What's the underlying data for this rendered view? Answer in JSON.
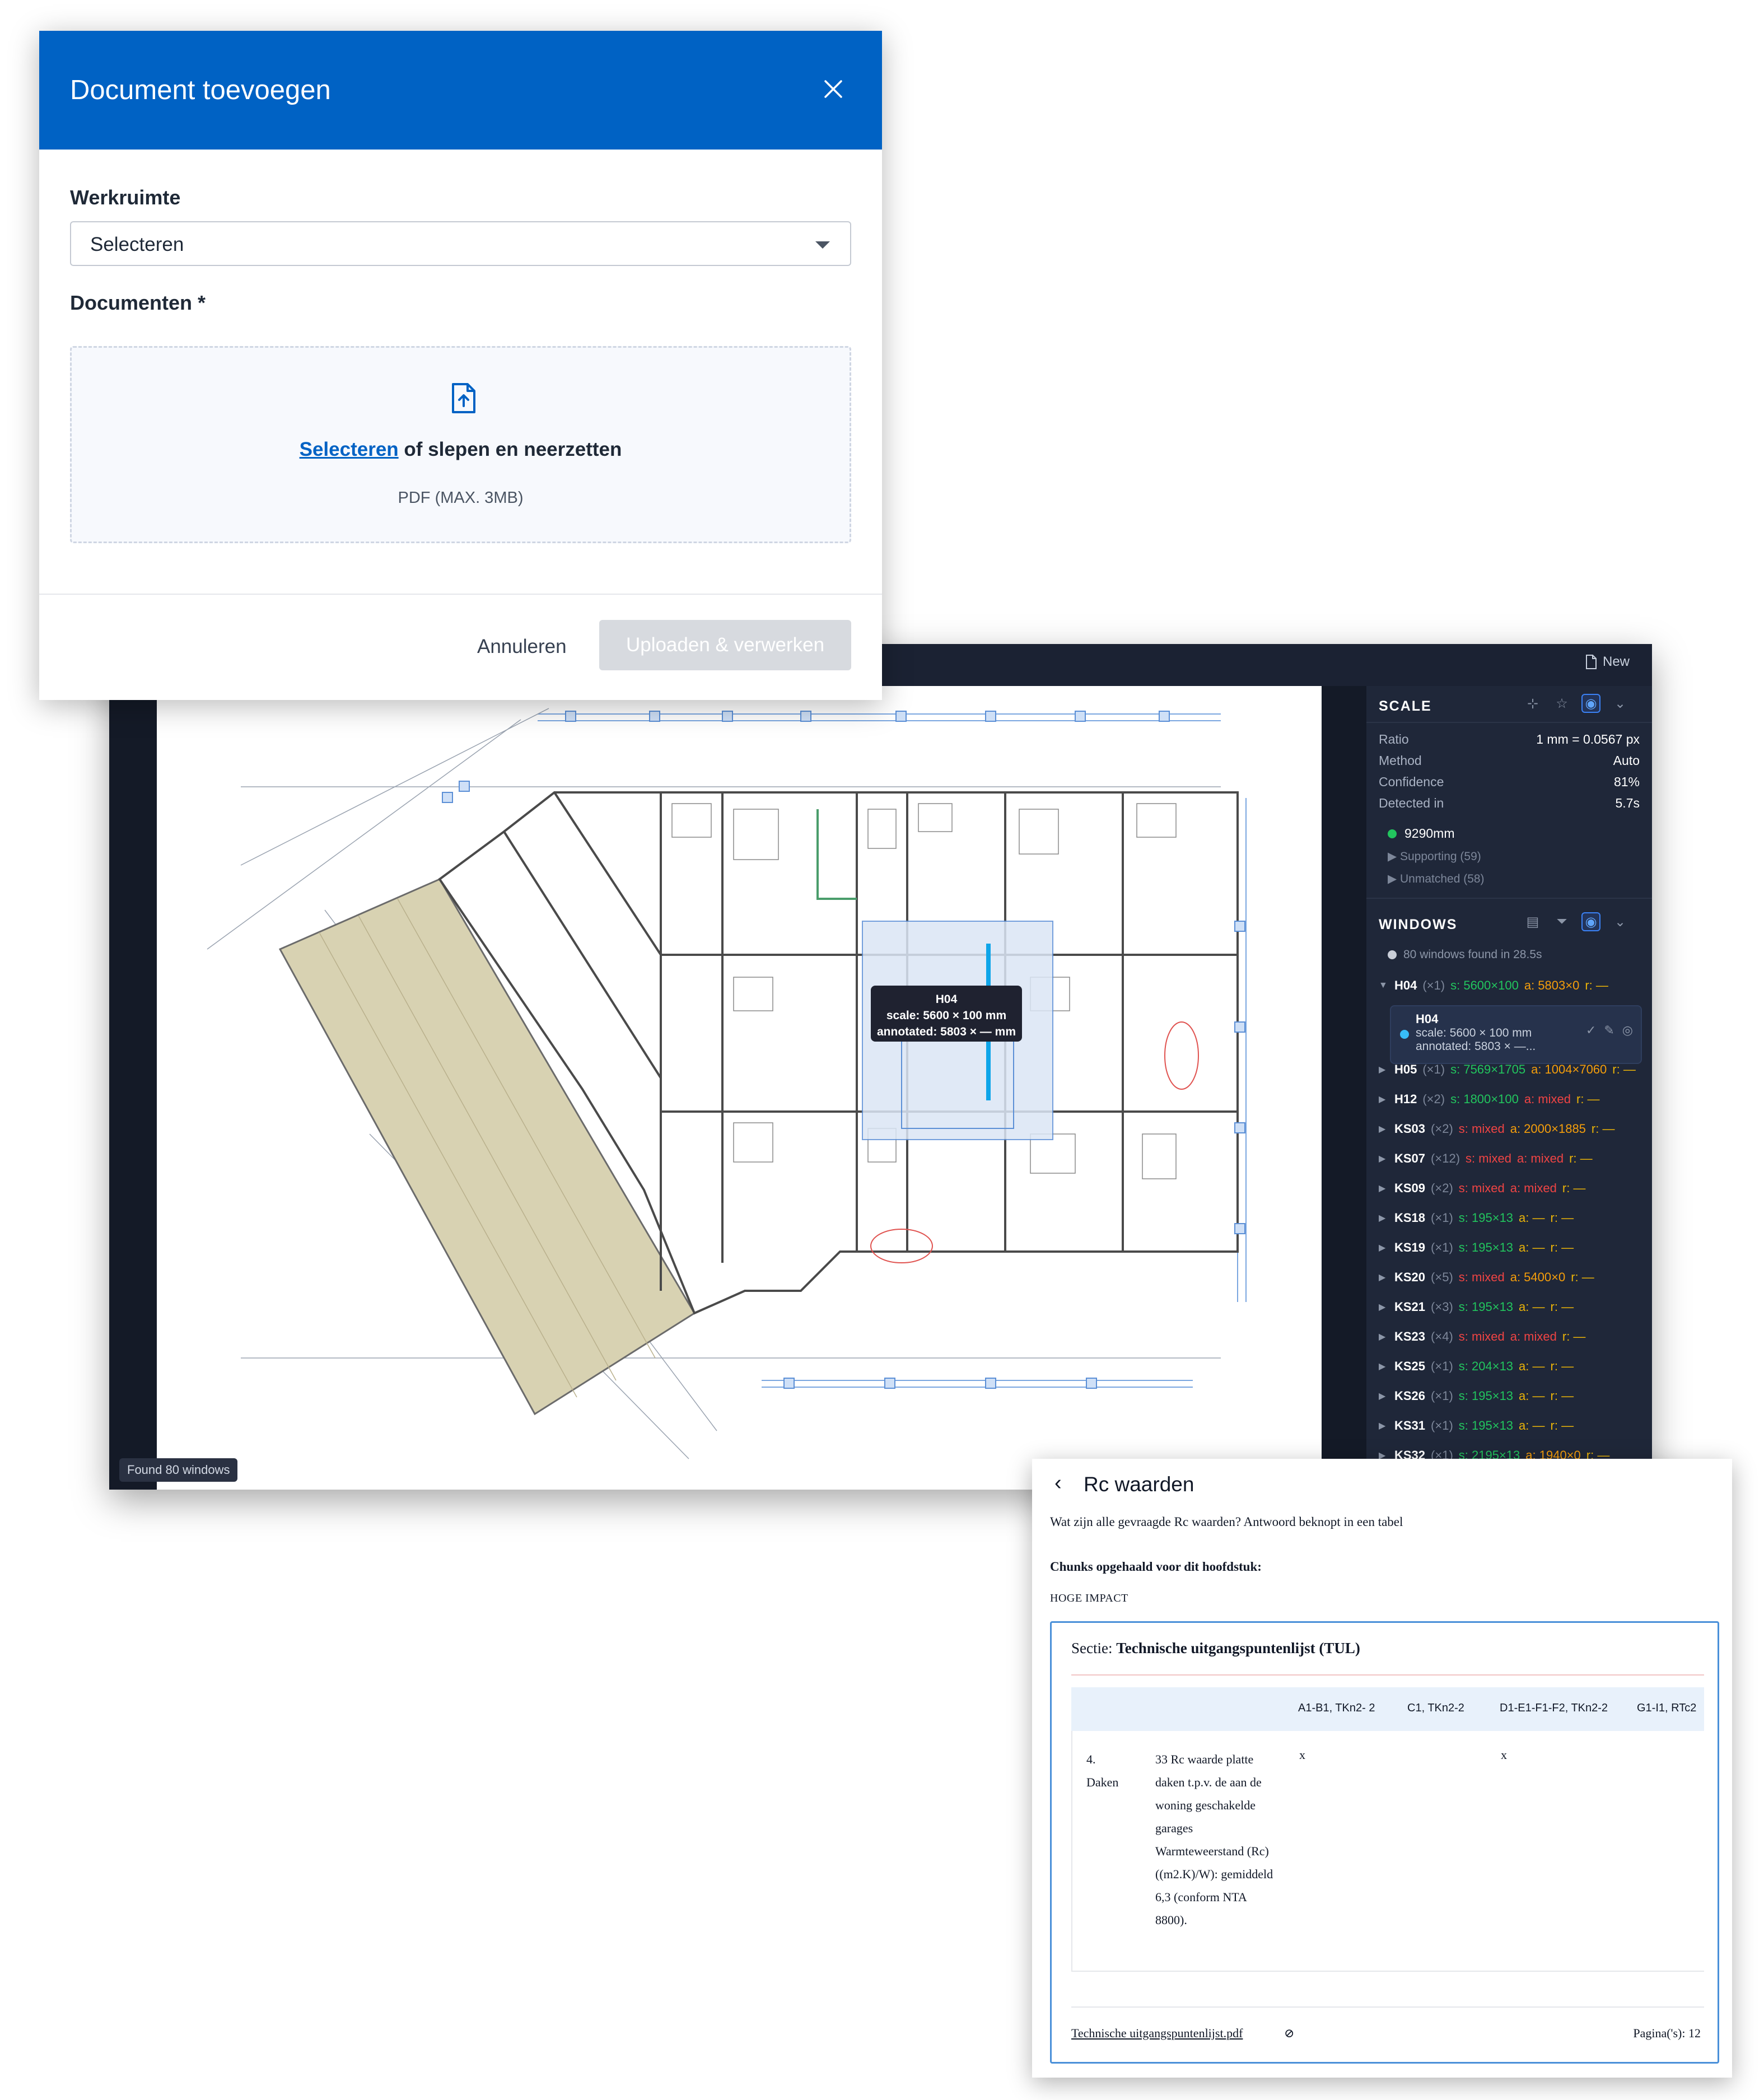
{
  "modal": {
    "title": "Document toevoegen",
    "workspace_label": "Werkruimte",
    "workspace_value": "Selecteren",
    "documents_label": "Documenten *",
    "drop_link": "Selecteren",
    "drop_text": " of slepen en neerzetten",
    "drop_hint": "PDF (MAX. 3MB)",
    "cancel_label": "Annuleren",
    "upload_label": "Uploaden & verwerken"
  },
  "viewer": {
    "new_label": "New",
    "found_badge": "Found 80 windows",
    "tooltip": {
      "title": "H04",
      "scale": "scale: 5600 × 100 mm",
      "annotated": "annotated: 5803 × — mm"
    }
  },
  "scale_panel": {
    "title": "SCALE",
    "rows": [
      {
        "k": "Ratio",
        "v": "1 mm = 0.0567 px"
      },
      {
        "k": "Method",
        "v": "Auto"
      },
      {
        "k": "Confidence",
        "v": "81%"
      },
      {
        "k": "Detected in",
        "v": "5.7s"
      }
    ],
    "measurement": "9290mm",
    "supporting": "▶ Supporting (59)",
    "unmatched": "▶ Unmatched (58)"
  },
  "windows_panel": {
    "title": "WINDOWS",
    "summary": "80 windows found in 28.5s",
    "selected": {
      "title": "H04",
      "scale": "scale: 5600 × 100 mm",
      "annotated": "annotated: 5803 × —..."
    },
    "items": [
      {
        "id": "H04",
        "count": "(×1)",
        "s": "s: 5600×100",
        "a": "a: 5803×0",
        "r": "r: —",
        "open": true
      },
      {
        "id": "H05",
        "count": "(×1)",
        "s": "s: 7569×1705",
        "a": "a: 1004×7060",
        "r": "r: —"
      },
      {
        "id": "H12",
        "count": "(×2)",
        "s": "s: 1800×100",
        "a": "a: mixed",
        "r": "r: —"
      },
      {
        "id": "KS03",
        "count": "(×2)",
        "s": "s: mixed",
        "a": "a: 2000×1885",
        "r": "r: —"
      },
      {
        "id": "KS07",
        "count": "(×12)",
        "s": "s: mixed",
        "a": "a: mixed",
        "r": "r: —"
      },
      {
        "id": "KS09",
        "count": "(×2)",
        "s": "s: mixed",
        "a": "a: mixed",
        "r": "r: —"
      },
      {
        "id": "KS18",
        "count": "(×1)",
        "s": "s: 195×13",
        "a": "a: —",
        "r": "r: —"
      },
      {
        "id": "KS19",
        "count": "(×1)",
        "s": "s: 195×13",
        "a": "a: —",
        "r": "r: —"
      },
      {
        "id": "KS20",
        "count": "(×5)",
        "s": "s: mixed",
        "a": "a: 5400×0",
        "r": "r: —"
      },
      {
        "id": "KS21",
        "count": "(×3)",
        "s": "s: 195×13",
        "a": "a: —",
        "r": "r: —"
      },
      {
        "id": "KS23",
        "count": "(×4)",
        "s": "s: mixed",
        "a": "a: mixed",
        "r": "r: —"
      },
      {
        "id": "KS25",
        "count": "(×1)",
        "s": "s: 204×13",
        "a": "a: —",
        "r": "r: —"
      },
      {
        "id": "KS26",
        "count": "(×1)",
        "s": "s: 195×13",
        "a": "a: —",
        "r": "r: —"
      },
      {
        "id": "KS31",
        "count": "(×1)",
        "s": "s: 195×13",
        "a": "a: —",
        "r": "r: —"
      },
      {
        "id": "KS32",
        "count": "(×1)",
        "s": "s: 2195×13",
        "a": "a: 1940×0",
        "r": "r: —"
      }
    ]
  },
  "rc_card": {
    "title": "Rc waarden",
    "question": "Wat zijn alle gevraagde Rc waarden? Antwoord beknopt in een tabel",
    "chunks_label": "Chunks opgehaald voor dit hoofdstuk:",
    "impact_label": "HOGE IMPACT",
    "sectie_prefix": "Sectie: ",
    "sectie_title": "Technische uitgangspuntenlijst (TUL)",
    "columns": [
      "A1-B1, TKn2- 2",
      "C1, TKn2-2",
      "D1-E1-F1-F2, TKn2-2",
      "G1-I1, RTc2"
    ],
    "row_num": "4.\nDaken",
    "row_text": "33 Rc waarde platte daken t.p.v. de aan de woning geschakelde garages Warmteweerstand (Rc)((m2.K)/W): gemiddeld 6,3 (conform NTA 8800).",
    "x_mark": "x",
    "pdf_name": "Technische uitgangspuntenlijst.pdf",
    "pages": "Pagina('s): 12"
  }
}
